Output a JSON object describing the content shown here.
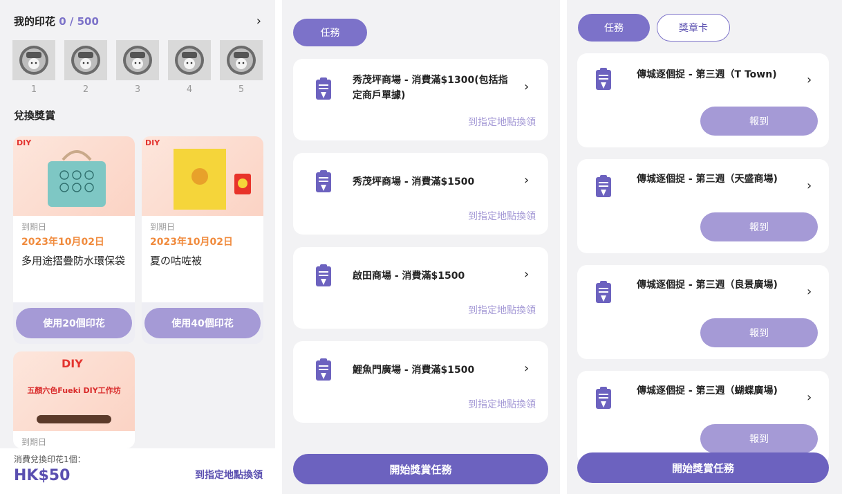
{
  "panel1": {
    "title_prefix": "我的印花",
    "count": "0 / 500",
    "stamps": [
      "1",
      "2",
      "3",
      "4",
      "5"
    ],
    "section_title": "兌換獎賞",
    "rewards": [
      {
        "expiry_label": "到期日",
        "date": "2023年10月02日",
        "name": "多用途摺疊防水環保袋",
        "button": "使用20個印花",
        "badge": "DIY"
      },
      {
        "expiry_label": "到期日",
        "date": "2023年10月02日",
        "name": "夏の咕咗被",
        "button": "使用40個印花",
        "badge": "DIY"
      },
      {
        "expiry_label": "到期日",
        "badge": "DIY",
        "banner": "五顏六色Fueki DIY工作坊"
      }
    ],
    "footer": {
      "label": "消費兌換印花1個：",
      "price": "HK$50",
      "link": "到指定地點換領"
    }
  },
  "panel2": {
    "tab": "任務",
    "tasks": [
      {
        "title": "秀茂坪商場 - 消費滿$1300(包括指定商戶單據)",
        "link": "到指定地點換領"
      },
      {
        "title": "秀茂坪商場 - 消費滿$1500",
        "link": "到指定地點換領"
      },
      {
        "title": "啟田商場 - 消費滿$1500",
        "link": "到指定地點換領"
      },
      {
        "title": "鯉魚門廣場 - 消費滿$1500",
        "link": "到指定地點換領"
      }
    ],
    "start_button": "開始獎賞任務"
  },
  "panel3": {
    "tabs": [
      "任務",
      "獎章卡"
    ],
    "tasks": [
      {
        "title": "傳城逐個捉 - 第三週（T Town)",
        "button": "報到"
      },
      {
        "title": "傳城逐個捉 - 第三週（天盛商場)",
        "button": "報到"
      },
      {
        "title": "傳城逐個捉 - 第三週（良景廣場)",
        "button": "報到"
      },
      {
        "title": "傳城逐個捉 - 第三週（蝴蝶廣場)",
        "button": "報到"
      }
    ],
    "start_button": "開始獎賞任務"
  },
  "icons": {
    "chevron": "chevron-right-icon",
    "task": "clipboard-icon",
    "stamp": "mascot-stamp-icon"
  },
  "colors": {
    "accent": "#7c72c9",
    "accent_light": "#a59ad6",
    "date": "#f08a3c",
    "brand_dark": "#5a4fb0"
  }
}
